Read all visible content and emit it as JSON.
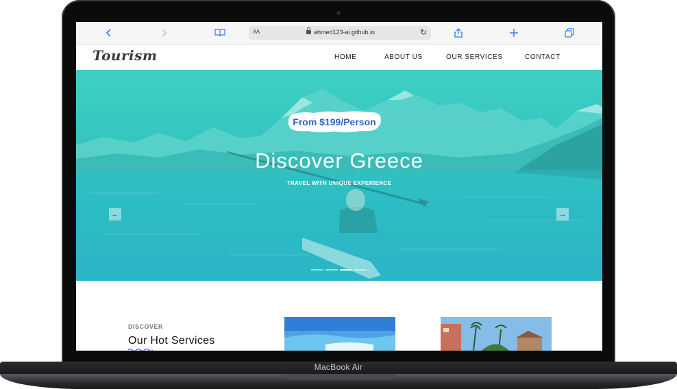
{
  "device": {
    "label": "MacBook Air"
  },
  "browser": {
    "url": "ahmed123-ai.github.io",
    "reader_label": "AA",
    "icons": [
      "back-icon",
      "forward-icon",
      "bookmarks-icon",
      "reload-icon",
      "share-icon",
      "new-tab-icon",
      "tabs-icon"
    ]
  },
  "site": {
    "logo": "Tourism",
    "nav": [
      "HOME",
      "ABOUT US",
      "OUR SERVICES",
      "CONTACT"
    ]
  },
  "hero": {
    "badge": "From $199/Person",
    "title": "Discover Greece",
    "subtitle": "TRAVEL WITH UNIQUE EXPERIENCE",
    "slide_count": 4,
    "active_slide": 3
  },
  "services": {
    "eyebrow": "DISCOVER",
    "title": "Our Hot Services"
  },
  "colors": {
    "hero_overlay": "#3ecfc4",
    "badge_text": "#2f63c8",
    "link_blue": "#2f7df6"
  }
}
